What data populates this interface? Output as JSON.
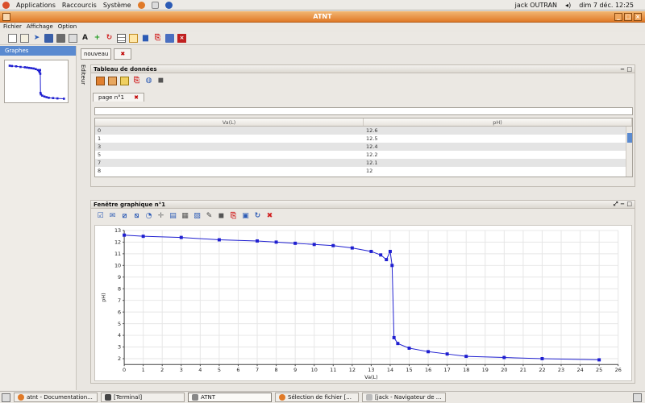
{
  "topbar": {
    "menus": [
      "Applications",
      "Raccourcis",
      "Système"
    ],
    "user": "jack OUTRAN",
    "datetime": "dim  7 déc. 12:25"
  },
  "window": {
    "title": "ATNT"
  },
  "menubar": [
    "Fichier",
    "Affichage",
    "Option"
  ],
  "toolbar_icons": [
    "new-file",
    "new-doc",
    "import-arrow",
    "save",
    "save-all",
    "print",
    "font",
    "add",
    "refresh",
    "table",
    "spreadsheet",
    "bar-chart",
    "pdf",
    "calculator",
    "close"
  ],
  "left_panel": {
    "header": "Graphes"
  },
  "side_strip": {
    "label": "Editeur"
  },
  "top_tabs": {
    "new_label": "nouveau",
    "close_label": "✖"
  },
  "table_panel": {
    "title": "Tableau de données",
    "page_tab": "page n°1",
    "columns": [
      "Va(L)",
      "pH)"
    ],
    "rows": [
      [
        "0",
        "12.6"
      ],
      [
        "1",
        "12.5"
      ],
      [
        "3",
        "12.4"
      ],
      [
        "5",
        "12.2"
      ],
      [
        "7",
        "12.1"
      ],
      [
        "8",
        "12"
      ]
    ]
  },
  "graph_panel": {
    "title": "Fenêtre graphique n°1"
  },
  "chart_data": {
    "type": "line",
    "xlabel": "Va(L)",
    "ylabel": "pH)",
    "xlim": [
      0,
      26
    ],
    "ylim": [
      1.5,
      13
    ],
    "xticks": [
      0,
      1,
      2,
      3,
      4,
      5,
      6,
      7,
      8,
      9,
      10,
      11,
      12,
      13,
      14,
      15,
      16,
      17,
      18,
      19,
      20,
      21,
      22,
      23,
      24,
      25,
      26
    ],
    "yticks": [
      2,
      3,
      4,
      5,
      6,
      7,
      8,
      9,
      10,
      11,
      12,
      13
    ],
    "grid": true,
    "color": "#1f1fd0",
    "x": [
      0,
      1,
      3,
      5,
      7,
      8,
      9,
      10,
      11,
      12,
      13,
      13.5,
      13.8,
      14,
      14.1,
      14.2,
      14.4,
      15,
      16,
      17,
      18,
      20,
      22,
      25
    ],
    "y": [
      12.6,
      12.5,
      12.4,
      12.2,
      12.1,
      12.0,
      11.9,
      11.8,
      11.7,
      11.5,
      11.2,
      10.9,
      10.5,
      11.2,
      10.0,
      3.8,
      3.3,
      2.9,
      2.6,
      2.4,
      2.2,
      2.1,
      2.0,
      1.9
    ]
  },
  "taskbar": {
    "items": [
      "atnt - Documentation...",
      "[Terminal]",
      "ATNT",
      "Sélection de fichier [...",
      "[jack - Navigateur de ..."
    ]
  },
  "colors": {
    "titlebar": "#e07a28",
    "selection": "#5a8ad0",
    "series": "#1f1fd0",
    "close_red": "#c00000"
  }
}
